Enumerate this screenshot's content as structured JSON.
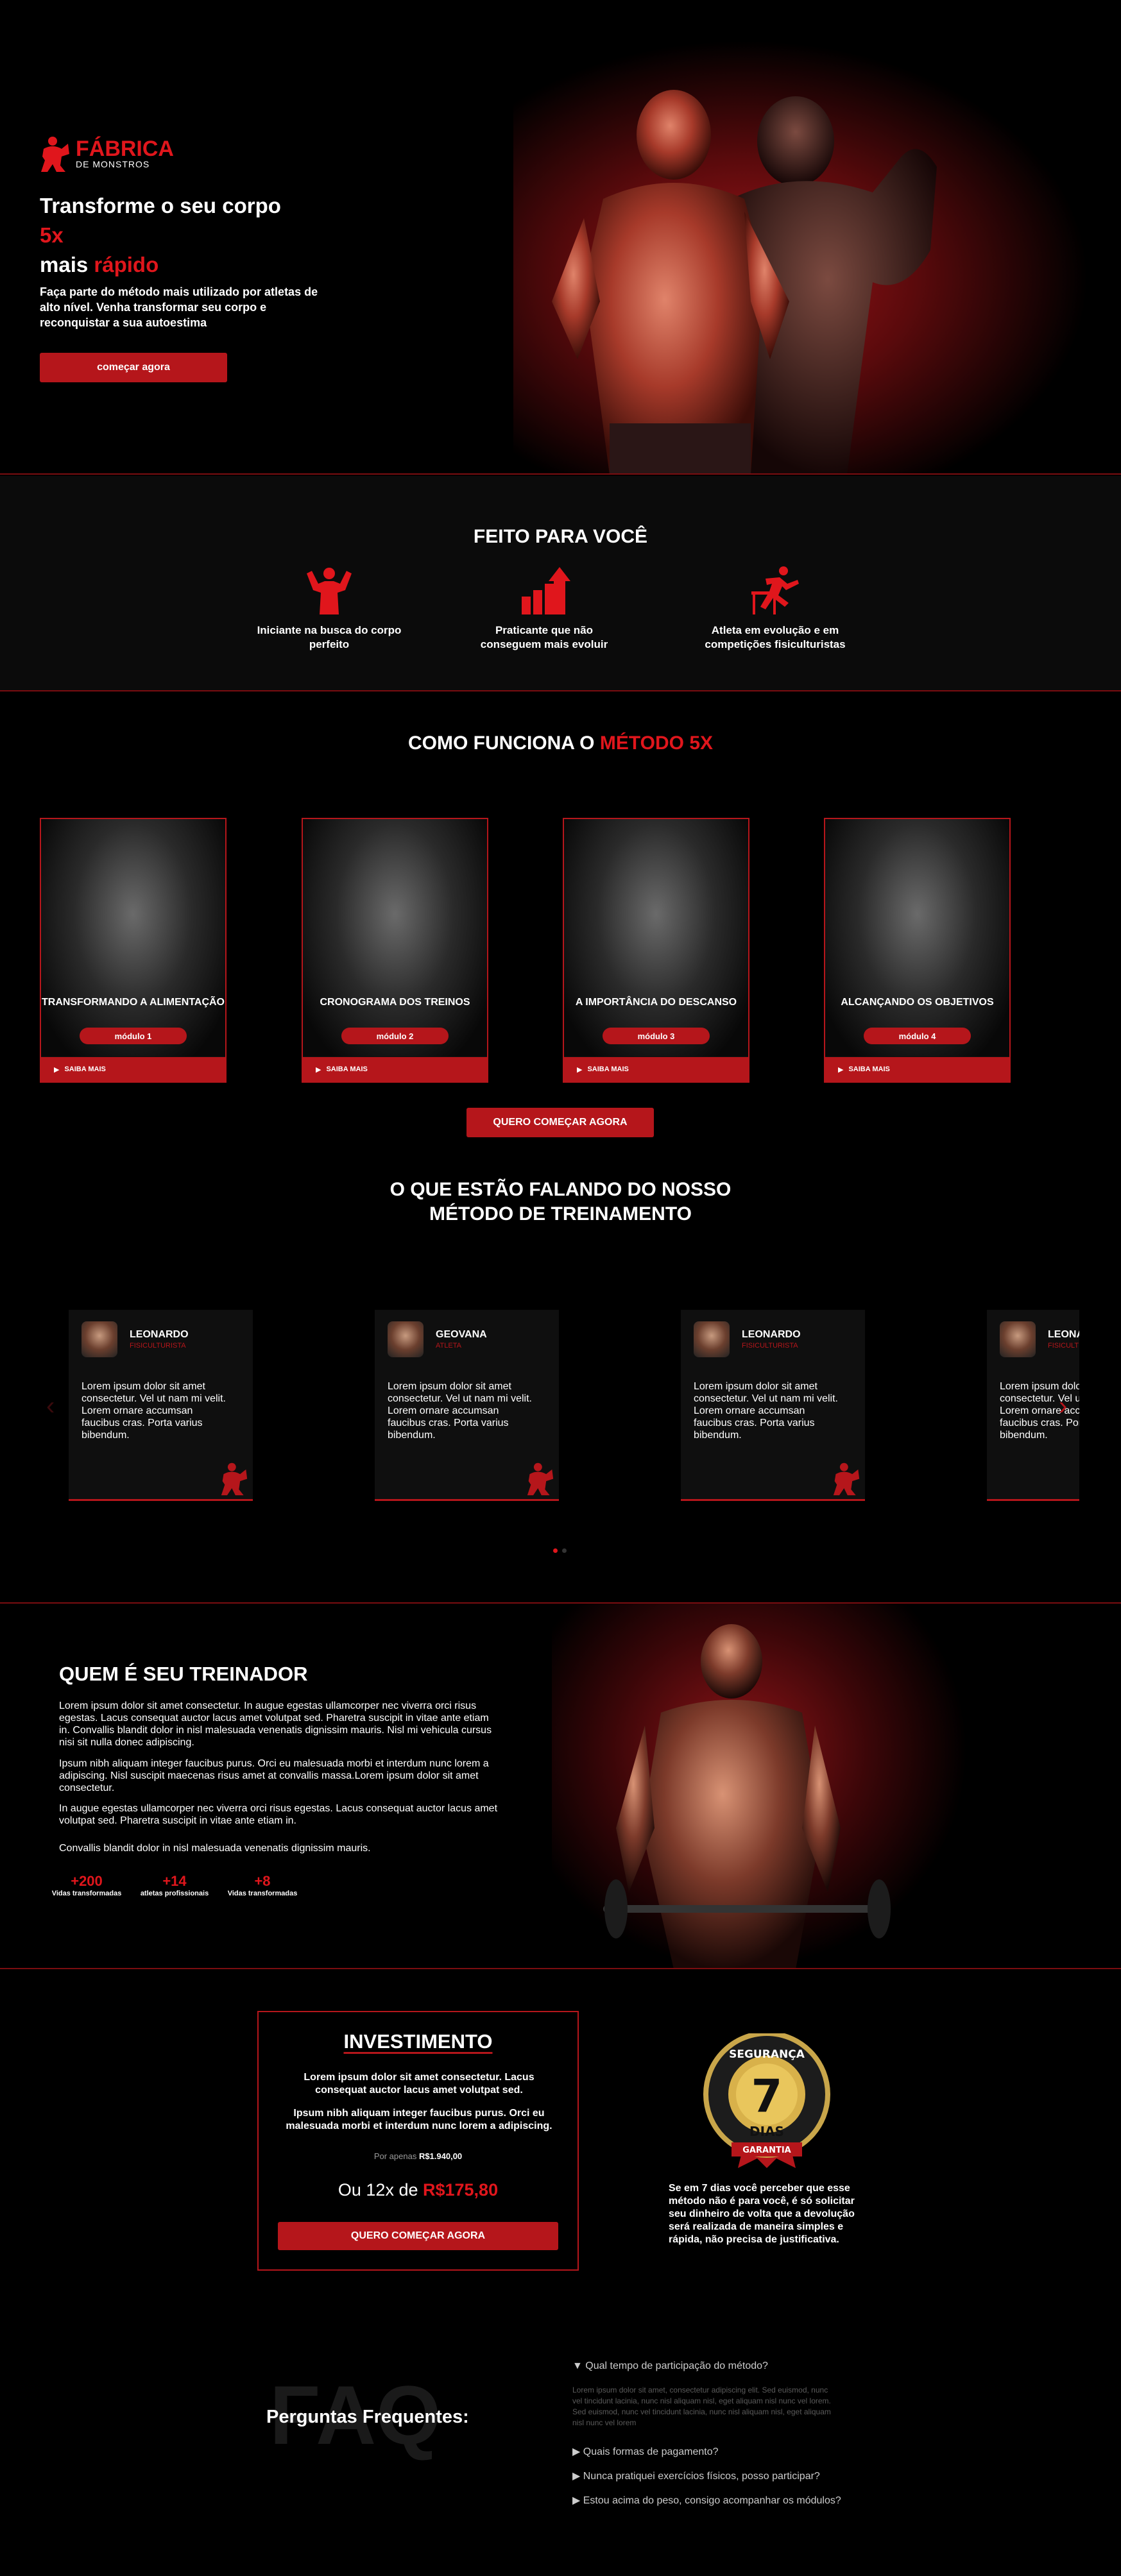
{
  "colors": {
    "accent": "#b5161b",
    "bright": "#e0161c",
    "bg": "#000000"
  },
  "hero": {
    "logo_line1": "FÁBRICA",
    "logo_line2": "DE MONSTROS",
    "title_line1": "Transforme o seu corpo",
    "title_accent1": "5x",
    "title_line3_a": "mais ",
    "title_accent2": "rápido",
    "description": "Faça parte do método mais utilizado por atletas de alto nível. Venha transformar seu corpo e reconquistar a sua autoestima",
    "cta": "começar agora"
  },
  "feito": {
    "title": "FEITO PARA VOCÊ",
    "items": [
      {
        "label": "Iniciante na busca do corpo perfeito",
        "icon": "bodybuilder-icon"
      },
      {
        "label": "Praticante que não conseguem mais evoluir",
        "icon": "growth-chart-icon"
      },
      {
        "label": "Atleta em evolução e em competições fisiculturistas",
        "icon": "hurdle-runner-icon"
      }
    ]
  },
  "metodo": {
    "title_a": "COMO FUNCIONA O ",
    "title_b": "MÉTODO 5X",
    "modules": [
      {
        "title": "TRANSFORMANDO A ALIMENTAÇÃO",
        "badge": "módulo 1",
        "more": "SAIBA MAIS"
      },
      {
        "title": "CRONOGRAMA DOS TREINOS",
        "badge": "módulo 2",
        "more": "SAIBA MAIS"
      },
      {
        "title": "A IMPORTÂNCIA DO DESCANSO",
        "badge": "módulo 3",
        "more": "SAIBA MAIS"
      },
      {
        "title": "ALCANÇANDO OS OBJETIVOS",
        "badge": "módulo 4",
        "more": "SAIBA MAIS"
      }
    ],
    "cta": "QUERO COMEÇAR AGORA"
  },
  "depoimentos": {
    "title_line1": "O QUE ESTÃO FALANDO DO NOSSO",
    "title_line2": "MÉTODO DE TREINAMENTO",
    "cards": [
      {
        "name": "LEONARDO",
        "role": "FISICULTURISTA",
        "text": "Lorem ipsum dolor sit amet consectetur. Vel ut nam mi velit. Lorem ornare accumsan faucibus cras. Porta varius bibendum."
      },
      {
        "name": "GEOVANA",
        "role": "ATLETA",
        "text": "Lorem ipsum dolor sit amet consectetur. Vel ut nam mi velit. Lorem ornare accumsan faucibus cras. Porta varius bibendum."
      },
      {
        "name": "LEONARDO",
        "role": "FISICULTURISTA",
        "text": "Lorem ipsum dolor sit amet consectetur. Vel ut nam mi velit. Lorem ornare accumsan faucibus cras. Porta varius bibendum."
      },
      {
        "name": "LEONA",
        "role": "FISICULTURISTA",
        "text": "Lorem ipsum dolor sit amet consectetur. Vel ut nam mi velit. Lorem ornare accumsan faucibus cras. Porta varius bibendum."
      }
    ]
  },
  "treinador": {
    "title": "QUEM É SEU TREINADOR",
    "p1": "Lorem ipsum dolor sit amet consectetur. In augue egestas ullamcorper nec viverra orci risus egestas. Lacus consequat auctor lacus amet volutpat sed. Pharetra suscipit in vitae ante etiam in. Convallis blandit dolor in nisl malesuada venenatis dignissim mauris. Nisl mi vehicula cursus nisi sit nulla donec adipiscing.",
    "p2": "Ipsum nibh aliquam integer faucibus purus. Orci eu malesuada morbi et interdum nunc lorem a adipiscing. Nisl suscipit maecenas risus amet at convallis massa.Lorem ipsum dolor sit amet consectetur.",
    "p3": "In augue egestas ullamcorper nec viverra orci risus egestas. Lacus consequat auctor lacus amet volutpat sed. Pharetra suscipit in vitae ante etiam in.",
    "p4": "Convallis blandit dolor in nisl malesuada venenatis dignissim mauris.",
    "stats": [
      {
        "n": "+200",
        "l": "Vidas transformadas"
      },
      {
        "n": "+14",
        "l": "atletas profissionais"
      },
      {
        "n": "+8",
        "l": "Vidas transformadas"
      }
    ]
  },
  "investimento": {
    "title": "INVESTIMENTO",
    "p1": "Lorem ipsum dolor sit amet consectetur. Lacus consequat auctor lacus amet volutpat sed.",
    "p2": "Ipsum nibh aliquam integer faucibus purus. Orci eu malesuada morbi et interdum nunc lorem a adipiscing.",
    "old_prefix": "Por apenas ",
    "old_price": "R$1.940,00",
    "installments_prefix": "Ou 12x de ",
    "installment_value": "R$175,80",
    "cta": "QUERO COMEÇAR AGORA"
  },
  "garantia": {
    "seal_top": "SEGURANÇA",
    "seal_number": "7",
    "seal_days": "DIAS",
    "seal_ribbon": "GARANTIA",
    "text": "Se em 7 dias você perceber que esse método não é para você, é só solicitar seu dinheiro de volta que a devolução será realizada de maneira simples e rápida, não precisa de justificativa."
  },
  "faq": {
    "bg_word": "FAQ",
    "title": "Perguntas Frequentes:",
    "items": [
      {
        "q": "Qual tempo de participação do método?",
        "a": "Lorem ipsum dolor sit amet, consectetur adipiscing elit. Sed euismod, nunc vel tincidunt lacinia, nunc nisl aliquam nisl, eget aliquam nisl nunc vel lorem. Sed euismod, nunc vel tincidunt lacinia, nunc nisl aliquam nisl, eget aliquam nisl nunc vel lorem"
      },
      {
        "q": "Quais formas de pagamento?"
      },
      {
        "q": "Nunca pratiquei exercícios físicos, posso participar?"
      },
      {
        "q": "Estou acima do peso, consigo acompanhar os módulos?"
      }
    ]
  }
}
